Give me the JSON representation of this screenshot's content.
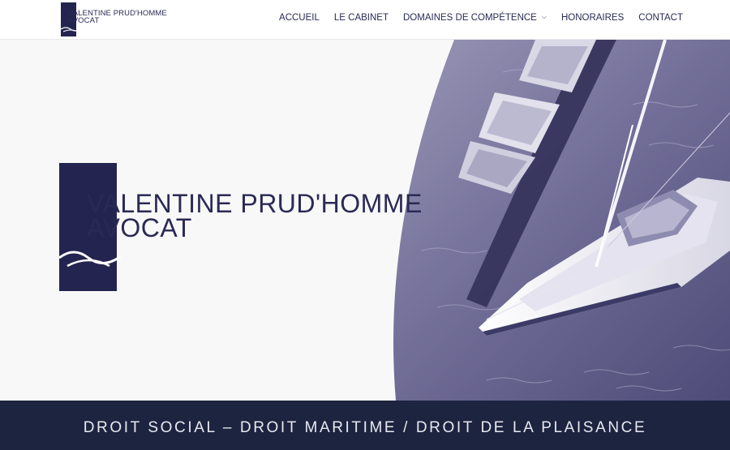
{
  "header": {
    "logo": {
      "line1": "VALENTINE PRUD'HOMME",
      "line2": "AVOCAT"
    },
    "nav": {
      "items": [
        {
          "label": "ACCUEIL"
        },
        {
          "label": "LE CABINET"
        },
        {
          "label": "DOMAINES DE COMPÉTENCE",
          "has_dropdown": true
        },
        {
          "label": "HONORAIRES"
        },
        {
          "label": "CONTACT"
        }
      ]
    }
  },
  "hero": {
    "title_line1": "VALENTINE PRUD'HOMME",
    "title_line2": "AVOCAT",
    "image": "sailboat-aerial-photo"
  },
  "band": {
    "tagline": "DROIT SOCIAL – DROIT MARITIME / DROIT DE LA PLAISANCE"
  },
  "colors": {
    "brand_navy": "#242451",
    "band_navy": "#1d2440",
    "text_navy": "#2a2a55",
    "hero_bg": "#f9f8f8"
  }
}
